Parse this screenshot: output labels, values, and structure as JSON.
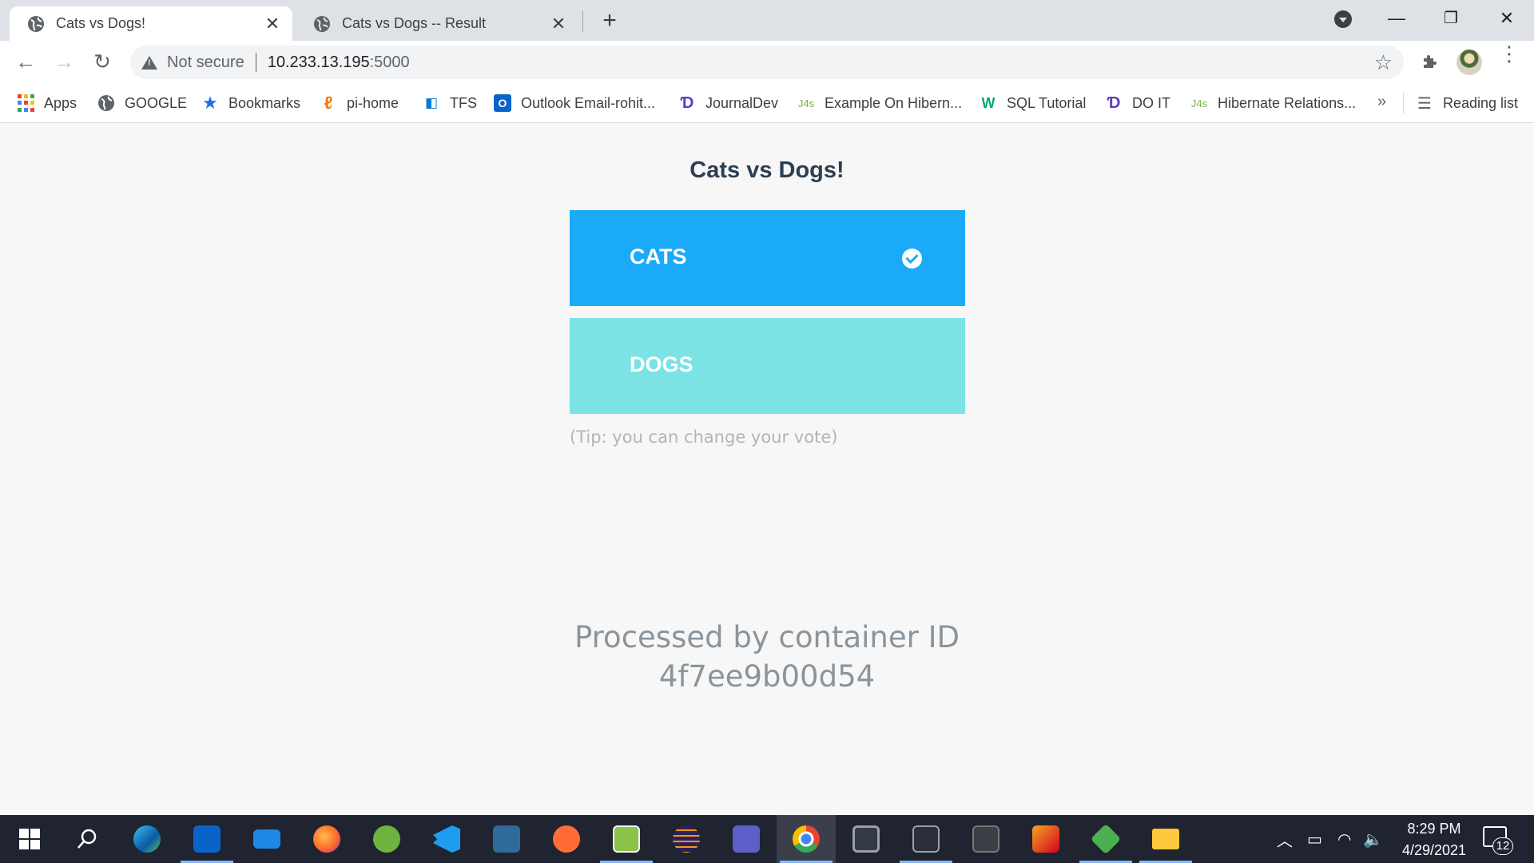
{
  "browser": {
    "tabs": [
      {
        "title": "Cats vs Dogs!",
        "active": true
      },
      {
        "title": "Cats vs Dogs -- Result",
        "active": false
      }
    ],
    "security_label": "Not secure",
    "url_host": "10.233.13.195",
    "url_port": ":5000",
    "bookmarks": [
      {
        "label": "Apps",
        "icon": "apps-grid-icon"
      },
      {
        "label": "GOOGLE",
        "icon": "globe-icon"
      },
      {
        "label": "Bookmarks",
        "icon": "star-icon"
      },
      {
        "label": "pi-home",
        "icon": "pi-icon"
      },
      {
        "label": "TFS",
        "icon": "tfs-icon"
      },
      {
        "label": "Outlook Email-rohit...",
        "icon": "outlook-icon"
      },
      {
        "label": "JournalDev",
        "icon": "journaldev-icon"
      },
      {
        "label": "Example On Hibern...",
        "icon": "j4s-icon"
      },
      {
        "label": "SQL Tutorial",
        "icon": "w3-icon"
      },
      {
        "label": "DO IT",
        "icon": "journaldev-icon"
      },
      {
        "label": "Hibernate Relations...",
        "icon": "j4s-icon"
      }
    ],
    "more_bookmarks": "»",
    "reading_list": "Reading list"
  },
  "page": {
    "title": "Cats vs Dogs!",
    "option_a": "CATS",
    "option_b": "DOGS",
    "selected": "CATS",
    "tip": "(Tip: you can change your vote)",
    "processed_line1": "Processed by container ID",
    "processed_line2": "4f7ee9b00d54"
  },
  "colors": {
    "cats": "#1aaaf8",
    "dogs": "#7be3e3",
    "title": "#2c3e50"
  },
  "taskbar": {
    "apps": [
      "start-icon",
      "search-icon",
      "edge-icon",
      "outlook-icon",
      "mail-icon",
      "firefox-icon",
      "spring-icon",
      "vscode-icon",
      "mysql-workbench-icon",
      "postman-icon",
      "notepadpp-icon",
      "eclipse-icon",
      "teams-icon",
      "chrome-icon",
      "vpn-icon",
      "snipping-icon",
      "cmd-icon",
      "filezilla-icon",
      "git-icon",
      "explorer-icon"
    ],
    "time": "8:29 PM",
    "date": "4/29/2021",
    "notifications": "12"
  }
}
